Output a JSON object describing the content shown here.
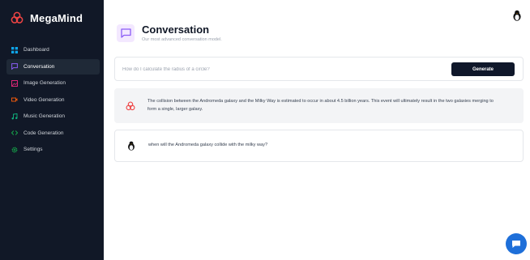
{
  "app": {
    "name": "MegaMind"
  },
  "colors": {
    "sidebar_bg": "#111827",
    "accent": "#8b5cf6",
    "button_bg": "#0f172a",
    "fab_bg": "#1e6fd9"
  },
  "sidebar": {
    "items": [
      {
        "label": "Dashboard",
        "icon": "dashboard-icon",
        "color": "#0ea5e9",
        "active": false
      },
      {
        "label": "Conversation",
        "icon": "chat-icon",
        "color": "#8b5cf6",
        "active": true
      },
      {
        "label": "Image Generation",
        "icon": "image-icon",
        "color": "#db2777",
        "active": false
      },
      {
        "label": "Video Generation",
        "icon": "video-icon",
        "color": "#ea580c",
        "active": false
      },
      {
        "label": "Music Generation",
        "icon": "music-icon",
        "color": "#10b981",
        "active": false
      },
      {
        "label": "Code Generation",
        "icon": "code-icon",
        "color": "#16a34a",
        "active": false
      },
      {
        "label": "Settings",
        "icon": "gear-icon",
        "color": "#16a34a",
        "active": false
      }
    ]
  },
  "header": {
    "title": "Conversation",
    "description": "Our most advanced conversation model."
  },
  "prompt": {
    "placeholder": "How do I calculate the radius of a circle?",
    "generate_label": "Generate"
  },
  "messages": [
    {
      "role": "bot",
      "text": "The collision between the Andromeda galaxy and the Milky Way is estimated to occur in about 4.5 billion years. This event will ultimately result in the two galaxies merging to form a single, larger galaxy."
    },
    {
      "role": "user",
      "text": "when will the Andromeda galaxy collide with the milky way?"
    }
  ]
}
